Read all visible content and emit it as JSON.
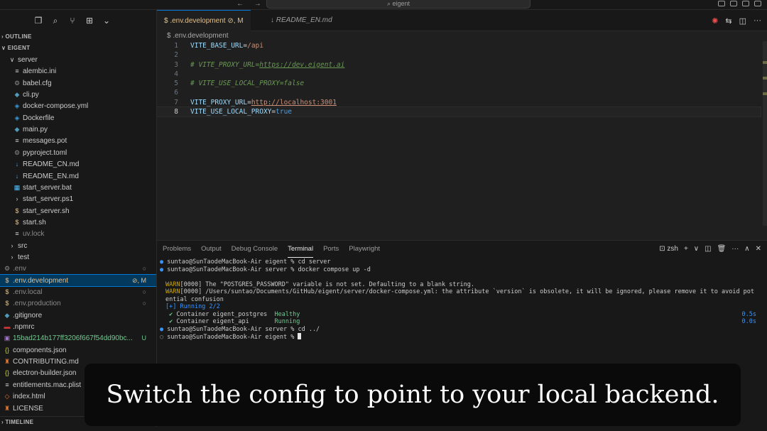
{
  "titlebar": {
    "nav_arrows": "← →",
    "search_text": "⌕ eigent"
  },
  "sidebar": {
    "toolbar_icons": [
      "files-icon",
      "search-icon",
      "source-control-icon",
      "extensions-icon",
      "chevron-down-icon"
    ],
    "outline_header": "OUTLINE",
    "explorer_header": "EIGENT",
    "timeline_header": "TIMELINE",
    "tree": [
      {
        "label": "server",
        "icon": "∨",
        "indent": 1,
        "type": "folder-open"
      },
      {
        "label": "alembic.ini",
        "icon": "≡",
        "indent": 2
      },
      {
        "label": "babel.cfg",
        "icon": "⚙",
        "indent": 2
      },
      {
        "label": "cli.py",
        "icon": "◆",
        "indent": 2
      },
      {
        "label": "docker-compose.yml",
        "icon": "◈",
        "indent": 2
      },
      {
        "label": "Dockerfile",
        "icon": "◈",
        "indent": 2
      },
      {
        "label": "main.py",
        "icon": "◆",
        "indent": 2
      },
      {
        "label": "messages.pot",
        "icon": "≡",
        "indent": 2
      },
      {
        "label": "pyproject.toml",
        "icon": "⚙",
        "indent": 2
      },
      {
        "label": "README_CN.md",
        "icon": "↓",
        "indent": 2
      },
      {
        "label": "README_EN.md",
        "icon": "↓",
        "indent": 2
      },
      {
        "label": "start_server.bat",
        "icon": "▦",
        "indent": 2
      },
      {
        "label": "start_server.ps1",
        "icon": "›",
        "indent": 2
      },
      {
        "label": "start_server.sh",
        "icon": "$",
        "indent": 2
      },
      {
        "label": "start.sh",
        "icon": "$",
        "indent": 2
      },
      {
        "label": "uv.lock",
        "icon": "≡",
        "indent": 2,
        "dim": true
      },
      {
        "label": "src",
        "icon": "›",
        "indent": 1
      },
      {
        "label": "test",
        "icon": "›",
        "indent": 1
      },
      {
        "label": ".env",
        "icon": "⚙",
        "indent": 0,
        "dim": true,
        "badge": "○"
      },
      {
        "label": ".env.development",
        "icon": "$",
        "indent": 0,
        "selected": true,
        "mod": true,
        "badge": "⊘, M"
      },
      {
        "label": ".env.local",
        "icon": "$",
        "indent": 0,
        "dim": true,
        "badge": "○"
      },
      {
        "label": ".env.production",
        "icon": "$",
        "indent": 0,
        "dim": true,
        "badge": "○"
      },
      {
        "label": ".gitignore",
        "icon": "◆",
        "indent": 0
      },
      {
        "label": ".npmrc",
        "icon": "▬",
        "indent": 0
      },
      {
        "label": "15bad214b177ff3206f667f54dd90bc...",
        "icon": "▣",
        "indent": 0,
        "untracked": true,
        "badge": "U"
      },
      {
        "label": "components.json",
        "icon": "{}",
        "indent": 0
      },
      {
        "label": "CONTRIBUTING.md",
        "icon": "♜",
        "indent": 0
      },
      {
        "label": "electron-builder.json",
        "icon": "{}",
        "indent": 0
      },
      {
        "label": "entitlements.mac.plist",
        "icon": "≡",
        "indent": 0
      },
      {
        "label": "index.html",
        "icon": "◇",
        "indent": 0
      },
      {
        "label": "LICENSE",
        "icon": "♜",
        "indent": 0
      }
    ]
  },
  "tabs": [
    {
      "label": "$ .env.development  ⊘, M",
      "active": true
    },
    {
      "label": "↓ README_EN.md",
      "active": false
    }
  ],
  "editor_actions": [
    "✺",
    "⇆",
    "◫",
    "···"
  ],
  "breadcrumb": "$ .env.development",
  "code_lines": [
    {
      "n": "1",
      "parts": [
        {
          "t": "VITE_BASE_URL",
          "c": "k"
        },
        {
          "t": "=",
          "c": ""
        },
        {
          "t": "/api",
          "c": "v"
        }
      ]
    },
    {
      "n": "2",
      "parts": []
    },
    {
      "n": "3",
      "parts": [
        {
          "t": "# VITE_PROXY_URL=",
          "c": "cm"
        },
        {
          "t": "https://dev.eigent.ai",
          "c": "cm url"
        }
      ]
    },
    {
      "n": "4",
      "parts": []
    },
    {
      "n": "5",
      "parts": [
        {
          "t": "# VITE_USE_LOCAL_PROXY=false",
          "c": "cm"
        }
      ]
    },
    {
      "n": "6",
      "parts": []
    },
    {
      "n": "7",
      "parts": [
        {
          "t": "VITE_PROXY_URL",
          "c": "k"
        },
        {
          "t": "=",
          "c": ""
        },
        {
          "t": "http://localhost:3001",
          "c": "v url"
        }
      ]
    },
    {
      "n": "8",
      "parts": [
        {
          "t": "VITE_USE_LOCAL_PROXY",
          "c": "k"
        },
        {
          "t": "=",
          "c": ""
        },
        {
          "t": "true",
          "c": "bool"
        }
      ],
      "current": true
    }
  ],
  "panel": {
    "tabs": [
      "Problems",
      "Output",
      "Debug Console",
      "Terminal",
      "Ports",
      "Playwright"
    ],
    "active_tab": "Terminal",
    "shell": "⊡ zsh",
    "actions": [
      "+",
      "∨",
      "◫",
      "🗑",
      "···",
      "∧",
      "✕"
    ]
  },
  "terminal_lines": [
    {
      "prefix": "●",
      "pc": "dot-b",
      "text": " suntao@SunTaodeMacBook-Air eigent % cd server"
    },
    {
      "prefix": "●",
      "pc": "dot-b",
      "text": " suntao@SunTaodeMacBook-Air server % docker compose up -d"
    },
    {
      "prefix": "",
      "pc": "",
      "text": ""
    },
    {
      "prefix": "WARN",
      "pc": "warn",
      "text": "[0000] The \"POSTGRES_PASSWORD\" variable is not set. Defaulting to a blank string.",
      "indent": true
    },
    {
      "prefix": "WARN",
      "pc": "warn",
      "text": "[0000] /Users/suntao/Documents/GitHub/eigent/server/docker-compose.yml: the attribute `version` is obsolete, it will be ignored, please remove it to avoid pot",
      "indent": true
    },
    {
      "prefix": "",
      "pc": "",
      "text": "ential confusion",
      "indent": true
    },
    {
      "prefix": "[+]",
      "pc": "blue",
      "text": " Running 2/2",
      "tc": "blue",
      "indent": true
    },
    {
      "prefix": " ✔",
      "pc": "ok",
      "text": " Container eigent_postgres  ",
      "status": "Healthy",
      "time": "0.5s",
      "indent": true
    },
    {
      "prefix": " ✔",
      "pc": "ok",
      "text": " Container eigent_api       ",
      "status": "Running",
      "time": "0.0s",
      "indent": true
    },
    {
      "prefix": "●",
      "pc": "dot-b",
      "text": " suntao@SunTaodeMacBook-Air server % cd ../"
    },
    {
      "prefix": "○",
      "pc": "dot-o",
      "text": " suntao@SunTaodeMacBook-Air eigent % ",
      "cursor": true
    }
  ],
  "caption": "Switch the config to point to your local backend."
}
